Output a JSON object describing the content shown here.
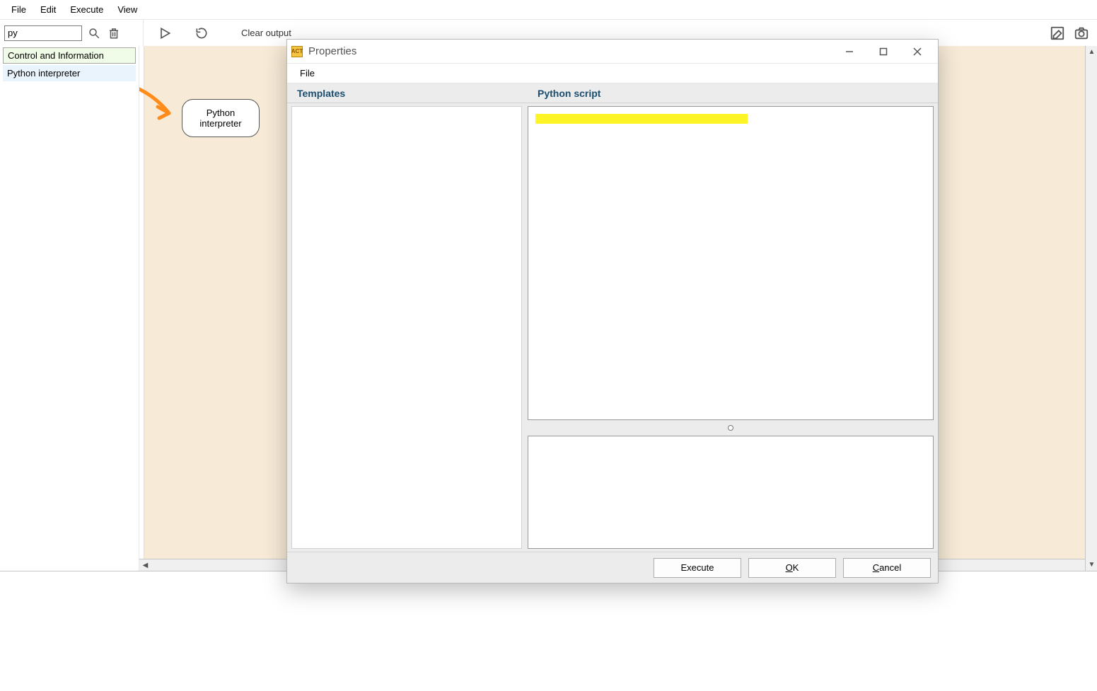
{
  "menubar": {
    "file": "File",
    "edit": "Edit",
    "execute": "Execute",
    "view": "View"
  },
  "toolbar": {
    "search_value": "py",
    "clear_output": "Clear output"
  },
  "sidebar": {
    "category": "Control and Information",
    "item": "Python interpreter"
  },
  "canvas": {
    "node_label": "Python interpreter"
  },
  "dialog": {
    "title": "Properties",
    "file_menu": "File",
    "tab_templates": "Templates",
    "tab_script": "Python script",
    "buttons": {
      "execute": "Execute",
      "ok_u": "O",
      "ok_rest": "K",
      "cancel_u": "C",
      "cancel_rest": "ancel"
    }
  }
}
